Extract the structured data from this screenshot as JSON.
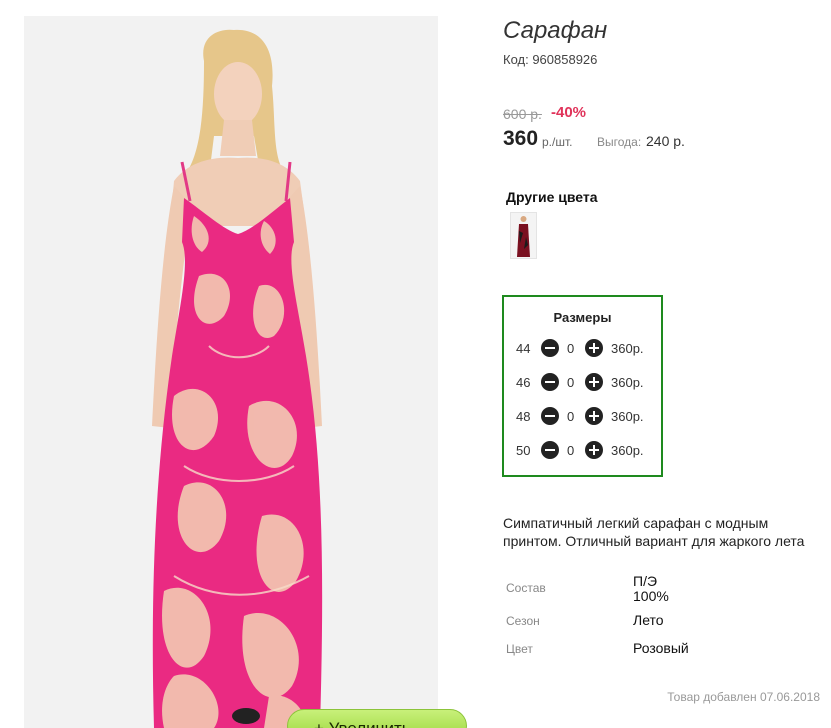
{
  "product": {
    "title": "Сарафан",
    "code": "Код: 960858926",
    "old_price": "600 р.",
    "discount": "-40%",
    "price": "360",
    "price_unit": "р./шт.",
    "benefit_label": "Выгода:",
    "benefit_value": "240 р."
  },
  "other_colors": {
    "title": "Другие цвета"
  },
  "sizes": {
    "title": "Размеры",
    "rows": [
      {
        "size": "44",
        "qty": "0",
        "price": "360р."
      },
      {
        "size": "46",
        "qty": "0",
        "price": "360р."
      },
      {
        "size": "48",
        "qty": "0",
        "price": "360р."
      },
      {
        "size": "50",
        "qty": "0",
        "price": "360р."
      }
    ]
  },
  "description": "Симпатичный легкий сарафан с модным принтом. Отличный вариант для жаркого лета",
  "properties": [
    {
      "label": "Состав",
      "value": "П/Э 100%"
    },
    {
      "label": "Сезон",
      "value": "Лето"
    },
    {
      "label": "Цвет",
      "value": "Розовый"
    }
  ],
  "added_date": "Товар добавлен 07.06.2018",
  "zoom_button": "+ Увеличить",
  "colors": {
    "dress_pink": "#ea2a82",
    "print_light": "#f3c9b2",
    "sizes_border": "#1e8a1e",
    "discount": "#e0335a",
    "zoom_button": "#a8dd47"
  }
}
